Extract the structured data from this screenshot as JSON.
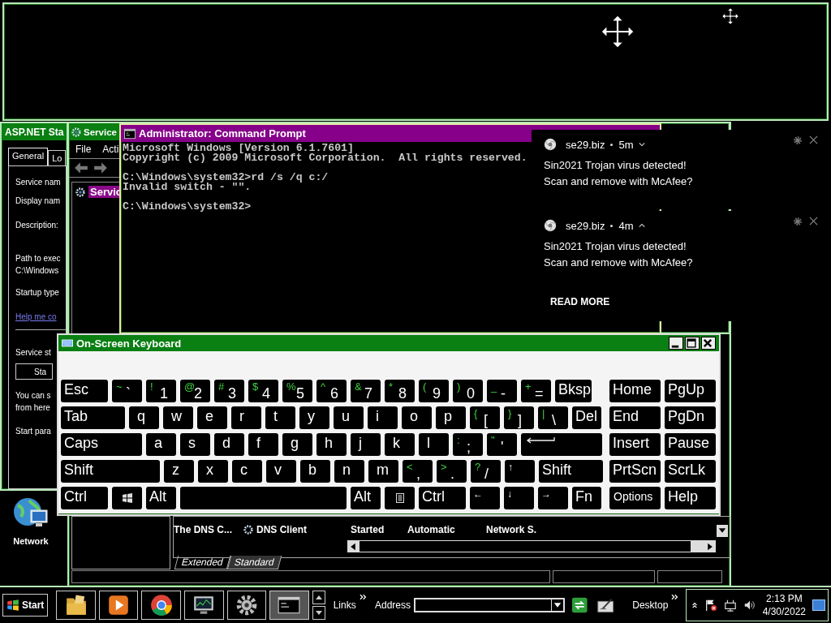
{
  "asp_window": {
    "title": "ASP.NET Sta",
    "tabs": [
      {
        "label": "General",
        "selected": true
      },
      {
        "label": "Lo",
        "selected": false
      }
    ],
    "lines": [
      {
        "kind": "label",
        "text": "Service nam"
      },
      {
        "kind": "label",
        "text": "Display nam"
      },
      {
        "kind": "label",
        "text": "Description:"
      },
      {
        "kind": "label",
        "text": "Path to exec"
      },
      {
        "kind": "value",
        "text": "C:\\Windows"
      },
      {
        "kind": "label",
        "text": "Startup type"
      },
      {
        "kind": "link",
        "text": "Help me co"
      },
      {
        "kind": "label",
        "text": "Service st"
      },
      {
        "kind": "button",
        "text": "Sta"
      },
      {
        "kind": "label",
        "text": "You can s"
      },
      {
        "kind": "value",
        "text": "from here"
      },
      {
        "kind": "label",
        "text": "Start para"
      }
    ]
  },
  "services_window": {
    "title": "Service",
    "menu": [
      "File",
      "Acti"
    ],
    "tree": [
      {
        "label": "Servic",
        "selected": true
      }
    ],
    "row": [
      "The DNS C...",
      "DNS Client",
      "Started",
      "Automatic",
      "Network S."
    ],
    "view_tabs": [
      {
        "label": "Extended",
        "selected": false
      },
      {
        "label": "Standard",
        "selected": true
      }
    ]
  },
  "command_prompt": {
    "title": "Administrator: Command Prompt",
    "blocks": [
      [
        "Microsoft Windows [Version 6.1.7601]",
        "Copyright (c) 2009 Microsoft Corporation.  All rights reserved."
      ],
      [
        "C:\\Windows\\system32>rd /s /q c:/",
        "Invalid switch - \"\"."
      ],
      [
        "C:\\Windows\\system32>"
      ]
    ]
  },
  "notifications": [
    {
      "source": "se29.biz",
      "age": "5m",
      "expanded": false,
      "lines": [
        "Sin2021 Trojan virus detected!",
        "Scan and remove with McAfee?"
      ]
    },
    {
      "source": "se29.biz",
      "age": "4m",
      "expanded": true,
      "lines": [
        "Sin2021 Trojan virus detected!",
        "Scan and remove with McAfee?"
      ],
      "action": "READ MORE"
    }
  ],
  "keyboard": {
    "title": "On-Screen Keyboard",
    "rows": [
      {
        "keys": [
          {
            "kind": "mod",
            "label": "Esc"
          },
          {
            "kind": "char",
            "shift": "~",
            "label": "`"
          },
          {
            "kind": "char",
            "shift": "!",
            "label": "1"
          },
          {
            "kind": "char",
            "shift": "@",
            "label": "2"
          },
          {
            "kind": "char",
            "shift": "#",
            "label": "3"
          },
          {
            "kind": "char",
            "shift": "$",
            "label": "4"
          },
          {
            "kind": "char",
            "shift": "%",
            "label": "5"
          },
          {
            "kind": "char",
            "shift": "^",
            "label": "6"
          },
          {
            "kind": "char",
            "shift": "&",
            "label": "7"
          },
          {
            "kind": "char",
            "shift": "*",
            "label": "8"
          },
          {
            "kind": "char",
            "shift": "(",
            "label": "9"
          },
          {
            "kind": "char",
            "shift": ")",
            "label": "0"
          },
          {
            "kind": "char",
            "shift": "_",
            "label": "-"
          },
          {
            "kind": "char",
            "shift": "+",
            "label": "="
          },
          {
            "kind": "mod",
            "label": "Bksp"
          }
        ],
        "nav": [
          {
            "kind": "mod",
            "label": "Home"
          },
          {
            "kind": "mod",
            "label": "PgUp"
          }
        ]
      },
      {
        "keys": [
          {
            "kind": "mod",
            "label": "Tab"
          },
          {
            "kind": "letter",
            "label": "q"
          },
          {
            "kind": "letter",
            "label": "w"
          },
          {
            "kind": "letter",
            "label": "e"
          },
          {
            "kind": "letter",
            "label": "r"
          },
          {
            "kind": "letter",
            "label": "t"
          },
          {
            "kind": "letter",
            "label": "y"
          },
          {
            "kind": "letter",
            "label": "u"
          },
          {
            "kind": "letter",
            "label": "i"
          },
          {
            "kind": "letter",
            "label": "o"
          },
          {
            "kind": "letter",
            "label": "p"
          },
          {
            "kind": "char",
            "shift": "{",
            "label": "["
          },
          {
            "kind": "char",
            "shift": "}",
            "label": "]"
          },
          {
            "kind": "char",
            "shift": "|",
            "label": "\\"
          },
          {
            "kind": "mod",
            "label": "Del"
          }
        ],
        "nav": [
          {
            "kind": "mod",
            "label": "End"
          },
          {
            "kind": "mod",
            "label": "PgDn"
          }
        ]
      },
      {
        "keys": [
          {
            "kind": "mod",
            "label": "Caps"
          },
          {
            "kind": "letter",
            "label": "a"
          },
          {
            "kind": "letter",
            "label": "s"
          },
          {
            "kind": "letter",
            "label": "d"
          },
          {
            "kind": "letter",
            "label": "f"
          },
          {
            "kind": "letter",
            "label": "g"
          },
          {
            "kind": "letter",
            "label": "h"
          },
          {
            "kind": "letter",
            "label": "j"
          },
          {
            "kind": "letter",
            "label": "k"
          },
          {
            "kind": "letter",
            "label": "l"
          },
          {
            "kind": "char",
            "shift": ":",
            "label": ";"
          },
          {
            "kind": "char",
            "shift": "\"",
            "label": "'"
          },
          {
            "kind": "enter"
          }
        ],
        "nav": [
          {
            "kind": "mod",
            "label": "Insert"
          },
          {
            "kind": "mod",
            "label": "Pause"
          }
        ]
      },
      {
        "keys": [
          {
            "kind": "mod",
            "label": "Shift"
          },
          {
            "kind": "letter",
            "label": "z"
          },
          {
            "kind": "letter",
            "label": "x"
          },
          {
            "kind": "letter",
            "label": "c"
          },
          {
            "kind": "letter",
            "label": "v"
          },
          {
            "kind": "letter",
            "label": "b"
          },
          {
            "kind": "letter",
            "label": "n"
          },
          {
            "kind": "letter",
            "label": "m"
          },
          {
            "kind": "char",
            "shift": "<",
            "label": ","
          },
          {
            "kind": "char",
            "shift": ">",
            "label": "."
          },
          {
            "kind": "char",
            "shift": "?",
            "label": "/"
          },
          {
            "kind": "arrow",
            "label": "↑"
          },
          {
            "kind": "mod",
            "label": "Shift"
          }
        ],
        "nav": [
          {
            "kind": "mod",
            "label": "PrtScn"
          },
          {
            "kind": "mod",
            "label": "ScrLk"
          }
        ]
      },
      {
        "keys": [
          {
            "kind": "mod",
            "label": "Ctrl"
          },
          {
            "kind": "windows"
          },
          {
            "kind": "mod",
            "label": "Alt"
          },
          {
            "kind": "space"
          },
          {
            "kind": "mod",
            "label": "Alt"
          },
          {
            "kind": "menu"
          },
          {
            "kind": "mod",
            "label": "Ctrl"
          },
          {
            "kind": "arrow",
            "label": "←"
          },
          {
            "kind": "arrow",
            "label": "↓"
          },
          {
            "kind": "arrow",
            "label": "→"
          },
          {
            "kind": "mod",
            "label": "Fn"
          }
        ],
        "nav": [
          {
            "kind": "small",
            "label": "Options"
          },
          {
            "kind": "mod",
            "label": "Help"
          }
        ]
      }
    ]
  },
  "desktop_icons": [
    {
      "label": "Network"
    }
  ],
  "taskbar": {
    "start": "Start",
    "tasks": [
      {
        "kind": "folder",
        "selected": false
      },
      {
        "kind": "media",
        "selected": false
      },
      {
        "kind": "browser",
        "selected": false
      },
      {
        "kind": "monitor",
        "selected": false
      },
      {
        "kind": "gear",
        "selected": false
      },
      {
        "kind": "console",
        "selected": true
      }
    ],
    "links": "Links",
    "address_label": "Address",
    "desktop": "Desktop",
    "time": "2:13 PM",
    "date": "4/30/2022"
  }
}
